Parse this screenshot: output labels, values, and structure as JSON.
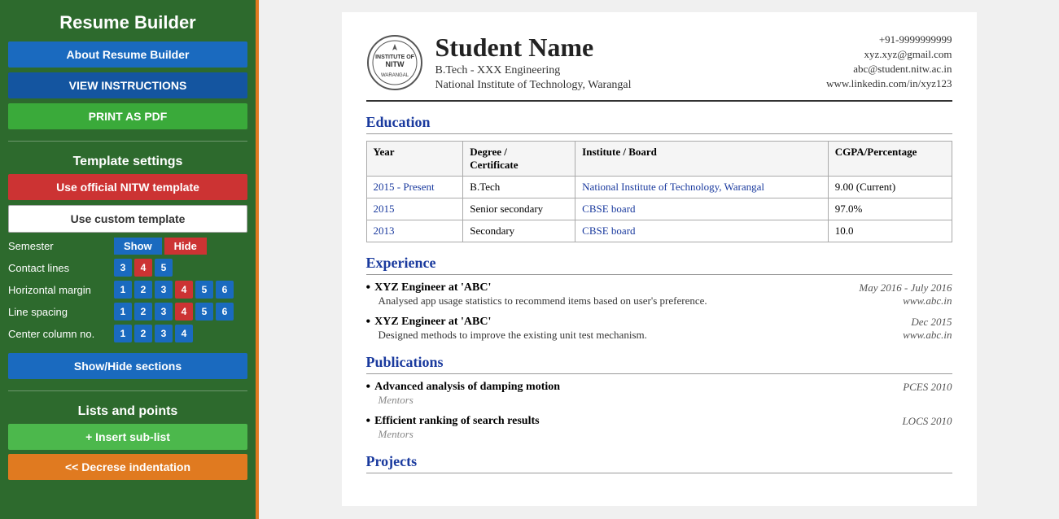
{
  "app": {
    "title": "Resume Builder"
  },
  "sidebar": {
    "title": "Resume Builder",
    "buttons": {
      "about": "About Resume Builder",
      "instructions": "VIEW INSTRUCTIONS",
      "print": "PRINT AS PDF"
    },
    "template_settings": {
      "title": "Template settings",
      "official_template": "Use official NITW template",
      "custom_template": "Use custom template",
      "semester_label": "Semester",
      "show_label": "Show",
      "hide_label": "Hide",
      "contact_lines_label": "Contact lines",
      "contact_values": [
        "3",
        "4",
        "5"
      ],
      "contact_active": "4",
      "horizontal_margin_label": "Horizontal margin",
      "horizontal_values": [
        "1",
        "2",
        "3",
        "4",
        "5",
        "6"
      ],
      "horizontal_active": "4",
      "line_spacing_label": "Line spacing",
      "line_values": [
        "1",
        "2",
        "3",
        "4",
        "5",
        "6"
      ],
      "line_active": "4",
      "center_col_label": "Center column no.",
      "center_values": [
        "1",
        "2",
        "3",
        "4"
      ],
      "center_active": null,
      "show_hide_btn": "Show/Hide sections"
    },
    "lists_points": {
      "title": "Lists and points",
      "insert_sub": "+ Insert sub-list",
      "decrease_indent": "<< Decrese indentation"
    }
  },
  "resume": {
    "logo_text": "NITW",
    "student_name": "Student Name",
    "degree": "B.Tech - XXX Engineering",
    "institute": "National Institute of Technology, Warangal",
    "phone": "+91-9999999999",
    "email1": "xyz.xyz@gmail.com",
    "email2": "abc@student.nitw.ac.in",
    "linkedin": "www.linkedin.com/in/xyz123",
    "sections": {
      "education": {
        "title": "Education",
        "table_headers": [
          "Year",
          "Degree / Certificate",
          "Institute / Board",
          "CGPA/Percentage"
        ],
        "rows": [
          {
            "year": "2015 - Present",
            "degree": "B.Tech",
            "institute": "National Institute of Technology, Warangal",
            "cgpa": "9.00 (Current)"
          },
          {
            "year": "2015",
            "degree": "Senior secondary",
            "institute": "CBSE board",
            "cgpa": "97.0%"
          },
          {
            "year": "2013",
            "degree": "Secondary",
            "institute": "CBSE board",
            "cgpa": "10.0"
          }
        ]
      },
      "experience": {
        "title": "Experience",
        "items": [
          {
            "title": "XYZ Engineer at 'ABC'",
            "date": "May 2016 - July 2016",
            "desc": "Analysed app usage statistics to recommend items based on user's preference.",
            "link": "www.abc.in"
          },
          {
            "title": "XYZ Engineer at 'ABC'",
            "date": "Dec 2015",
            "desc": "Designed methods to improve the existing unit test mechanism.",
            "link": "www.abc.in"
          }
        ]
      },
      "publications": {
        "title": "Publications",
        "items": [
          {
            "title": "Advanced analysis of damping motion",
            "venue": "PCES 2010",
            "sub": "Mentors"
          },
          {
            "title": "Efficient ranking of search results",
            "venue": "LOCS 2010",
            "sub": "Mentors"
          }
        ]
      },
      "projects": {
        "title": "Projects"
      }
    }
  }
}
